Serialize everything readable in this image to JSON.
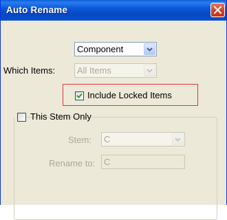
{
  "window": {
    "title": "Auto Rename"
  },
  "component_select": {
    "value": "Component"
  },
  "which_items": {
    "label": "Which Items:",
    "value": "All Items"
  },
  "include_locked": {
    "label": "Include Locked Items",
    "checked": true
  },
  "stem_only": {
    "label": "This Stem Only",
    "checked": false
  },
  "stem": {
    "label": "Stem:",
    "value": "C"
  },
  "rename_to": {
    "label": "Rename to:",
    "value": "C"
  },
  "colors": {
    "titlebar": "#0a5fd8",
    "dialog_bg": "#ece9d8",
    "highlight_border": "#e8313c",
    "disabled_text": "#aca899"
  }
}
